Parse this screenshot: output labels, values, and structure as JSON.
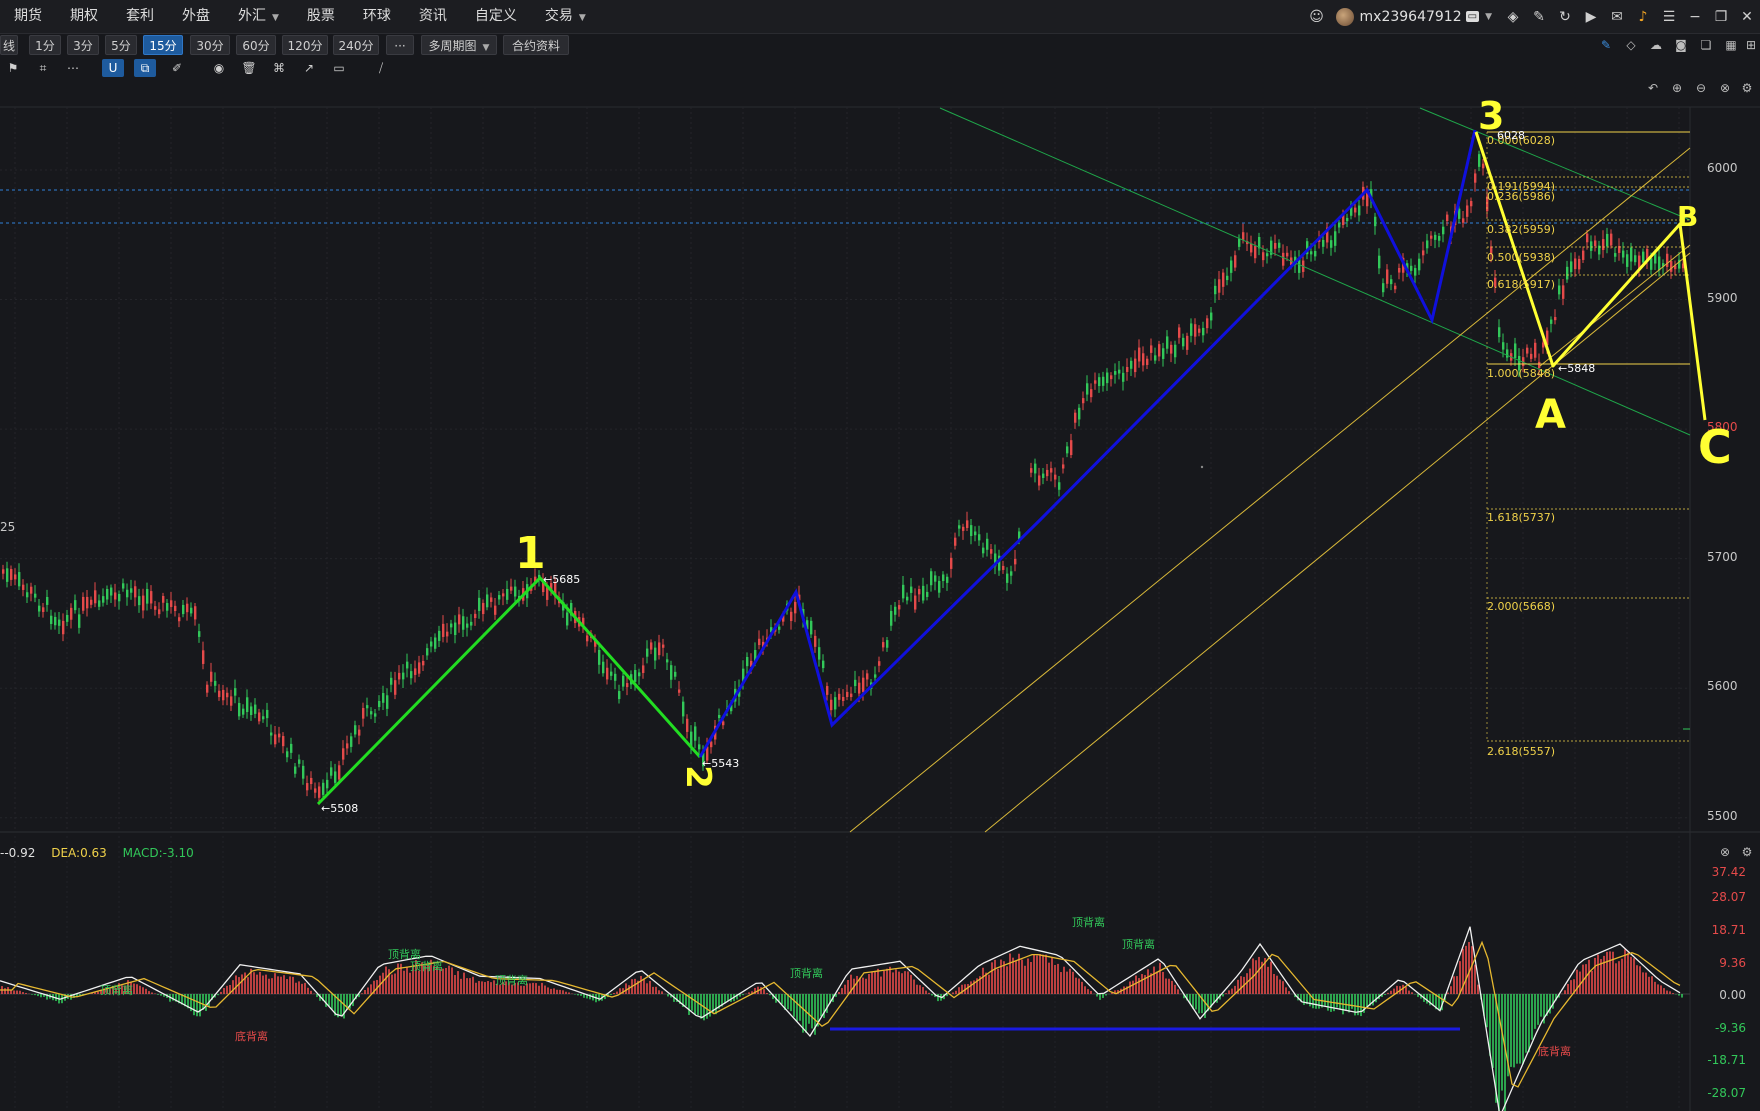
{
  "menu": {
    "items": [
      "期货",
      "期权",
      "套利",
      "外盘",
      "外汇",
      "股票",
      "环球",
      "资讯",
      "自定义",
      "交易"
    ],
    "dropdown_items": [
      "外汇",
      "交易"
    ]
  },
  "user": {
    "name": "mx239647912"
  },
  "timeframes": {
    "items": [
      "线",
      "1分",
      "3分",
      "5分",
      "15分",
      "30分",
      "60分",
      "120分",
      "240分",
      "···",
      "多周期图",
      "合约资料"
    ],
    "active": "15分"
  },
  "price_axis": {
    "labels": [
      "6000",
      "5900",
      "5800",
      "5700",
      "5600",
      "5500"
    ],
    "left_partial": "25"
  },
  "fib": {
    "levels": [
      {
        "label": "0.000(6028)",
        "ratio": 0
      },
      {
        "label": "0.191(5994)",
        "ratio": 0.191
      },
      {
        "label": "0.236(5986)",
        "ratio": 0.236
      },
      {
        "label": "0.382(5959)",
        "ratio": 0.382
      },
      {
        "label": "0.500(5938)",
        "ratio": 0.5
      },
      {
        "label": "0.618(5917)",
        "ratio": 0.618
      },
      {
        "label": "1.000(5848)",
        "ratio": 1
      },
      {
        "label": "1.618(5737)",
        "ratio": 1.618
      },
      {
        "label": "2.000(5668)",
        "ratio": 2
      },
      {
        "label": "2.618(5557)",
        "ratio": 2.618
      }
    ],
    "top_price": "6028"
  },
  "points": {
    "p5508": "←5508",
    "p5685": "←5685",
    "p5543": "←5543",
    "p6028": "6028",
    "p5848": "←5848"
  },
  "wave_labels": {
    "w1": "1",
    "w2": "2",
    "w3": "3",
    "wA": "A",
    "wB": "B",
    "wC": "C"
  },
  "macd": {
    "dif": "-0.92",
    "dea_label": "DEA:0.63",
    "macd_label": "MACD:-3.10",
    "axis": [
      "37.42",
      "28.07",
      "18.71",
      "9.36",
      "0.00",
      "-9.36",
      "-18.71",
      "-28.07"
    ],
    "divergences": [
      {
        "text": "顶背离",
        "color": "#32c85a"
      },
      {
        "text": "顶背离",
        "color": "#32c85a"
      },
      {
        "text": "顶背离",
        "color": "#32c85a"
      },
      {
        "text": "顶背离",
        "color": "#32c85a"
      },
      {
        "text": "顶背离",
        "color": "#32c85a"
      },
      {
        "text": "顶背离",
        "color": "#32c85a"
      },
      {
        "text": "顶背离",
        "color": "#32c85a"
      },
      {
        "text": "底背离",
        "color": "#e54a4a"
      },
      {
        "text": "底背离",
        "color": "#e54a4a"
      }
    ]
  },
  "colors": {
    "up": "#e54a4a",
    "down": "#32c85a",
    "fib": "#f0d24a",
    "wave_green": "#22dd22",
    "wave_blue": "#1010dd",
    "hand": "#ffff33"
  }
}
